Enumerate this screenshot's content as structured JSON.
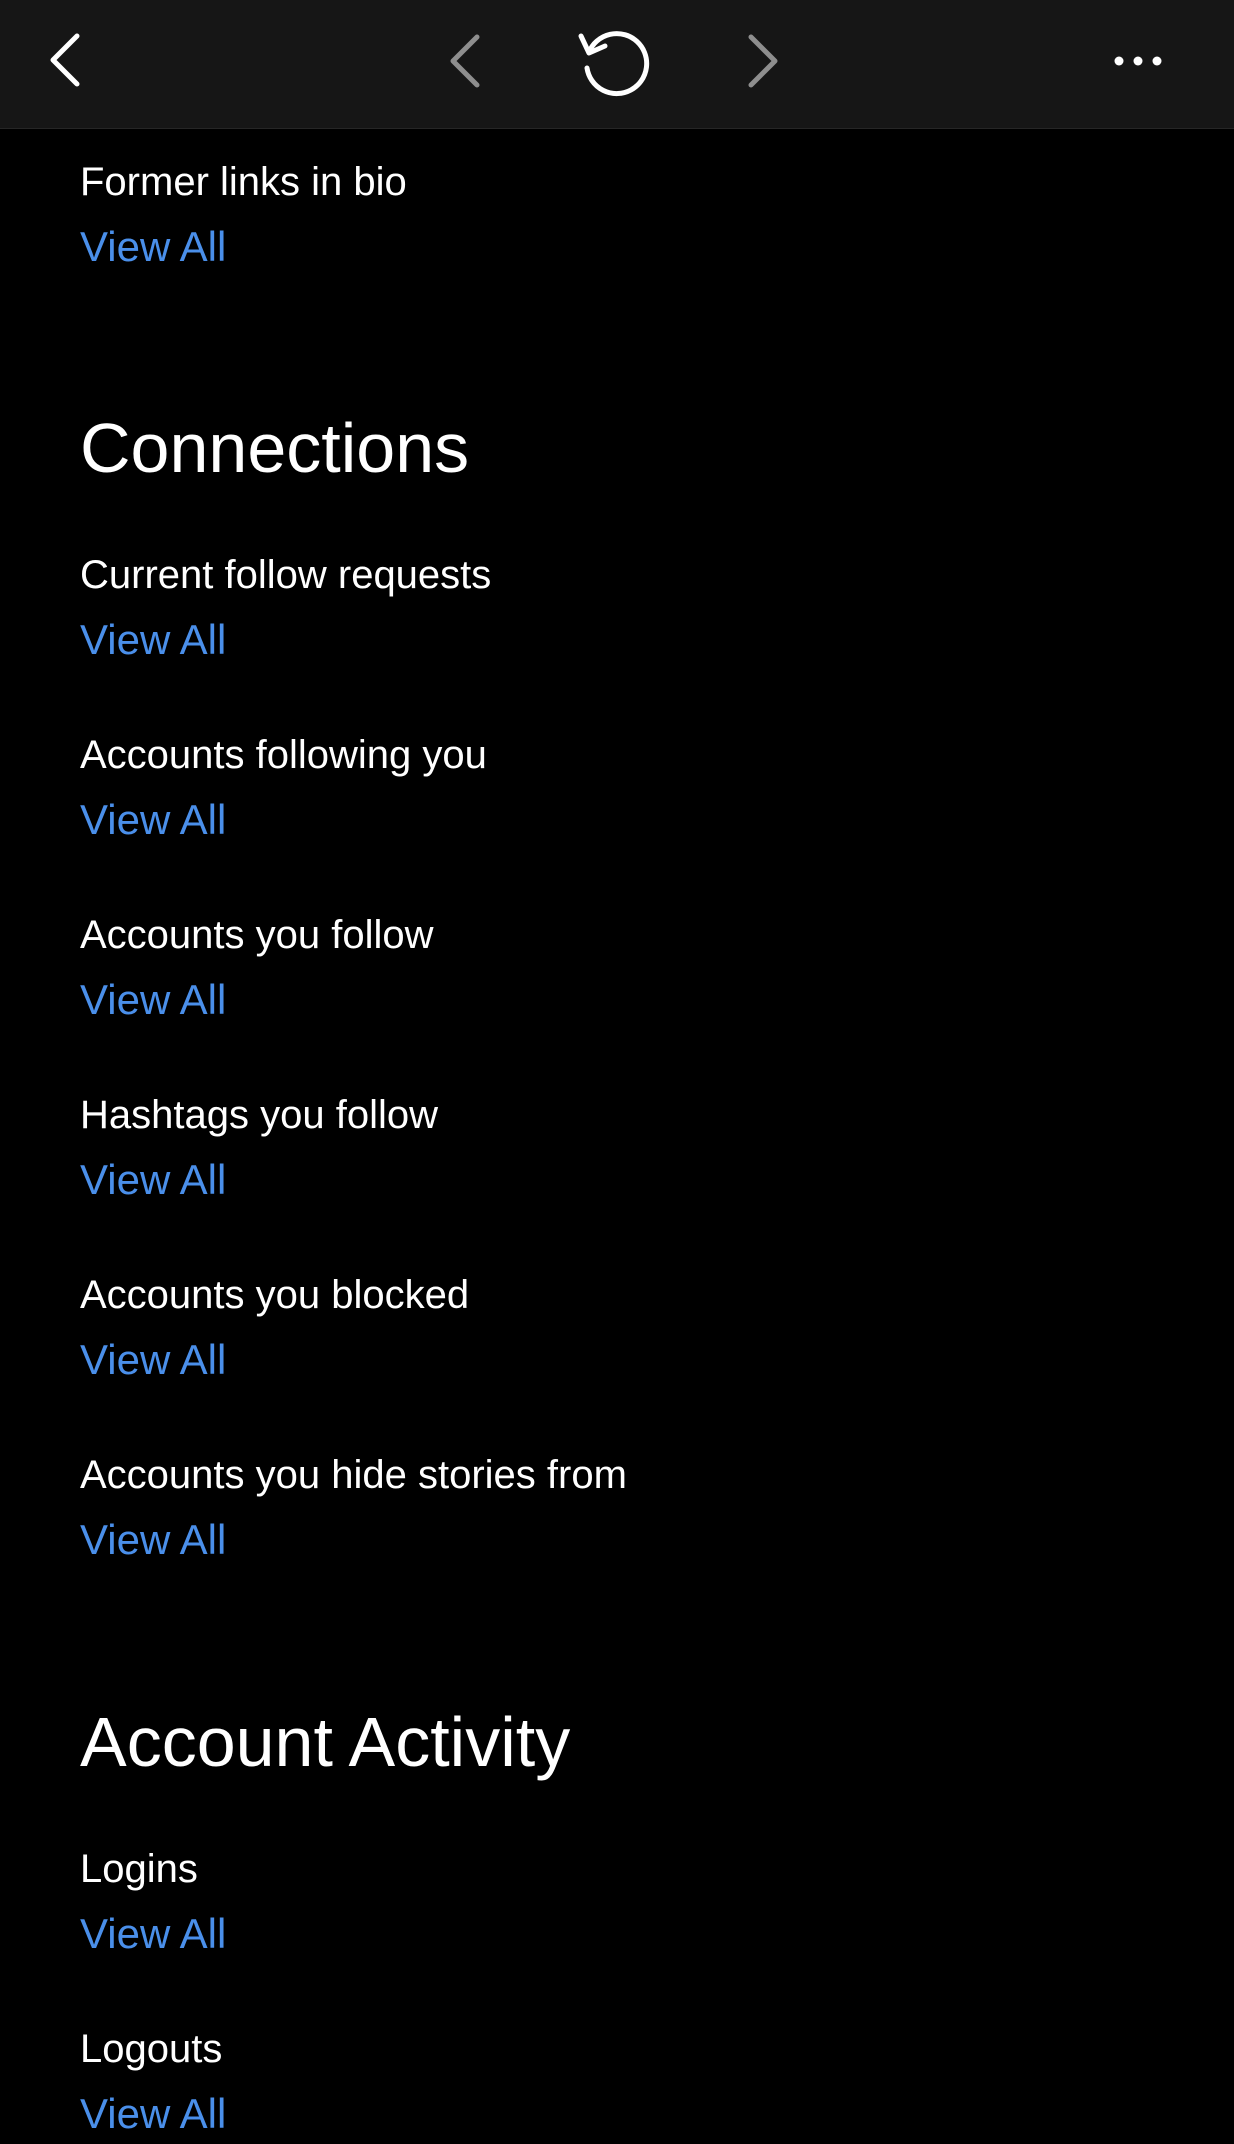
{
  "toolbar": {
    "close_icon": "chevron-left-icon",
    "back_icon": "chevron-left-icon",
    "reload_icon": "reload-icon",
    "forward_icon": "chevron-right-icon",
    "more_icon": "more-horizontal-icon"
  },
  "colors": {
    "background": "#000000",
    "toolbar": "#161616",
    "link": "#4a8fea",
    "text": "#ffffff",
    "disabled_icon": "#8e8e8e"
  },
  "former_links": {
    "label": "Former links in bio",
    "link": "View All"
  },
  "connections": {
    "heading": "Connections",
    "items": [
      {
        "label": "Current follow requests",
        "link": "View All"
      },
      {
        "label": "Accounts following you",
        "link": "View All"
      },
      {
        "label": "Accounts you follow",
        "link": "View All"
      },
      {
        "label": "Hashtags you follow",
        "link": "View All"
      },
      {
        "label": "Accounts you blocked",
        "link": "View All"
      },
      {
        "label": "Accounts you hide stories from",
        "link": "View All"
      }
    ]
  },
  "account_activity": {
    "heading": "Account Activity",
    "items": [
      {
        "label": "Logins",
        "link": "View All"
      },
      {
        "label": "Logouts",
        "link": "View All"
      }
    ]
  }
}
